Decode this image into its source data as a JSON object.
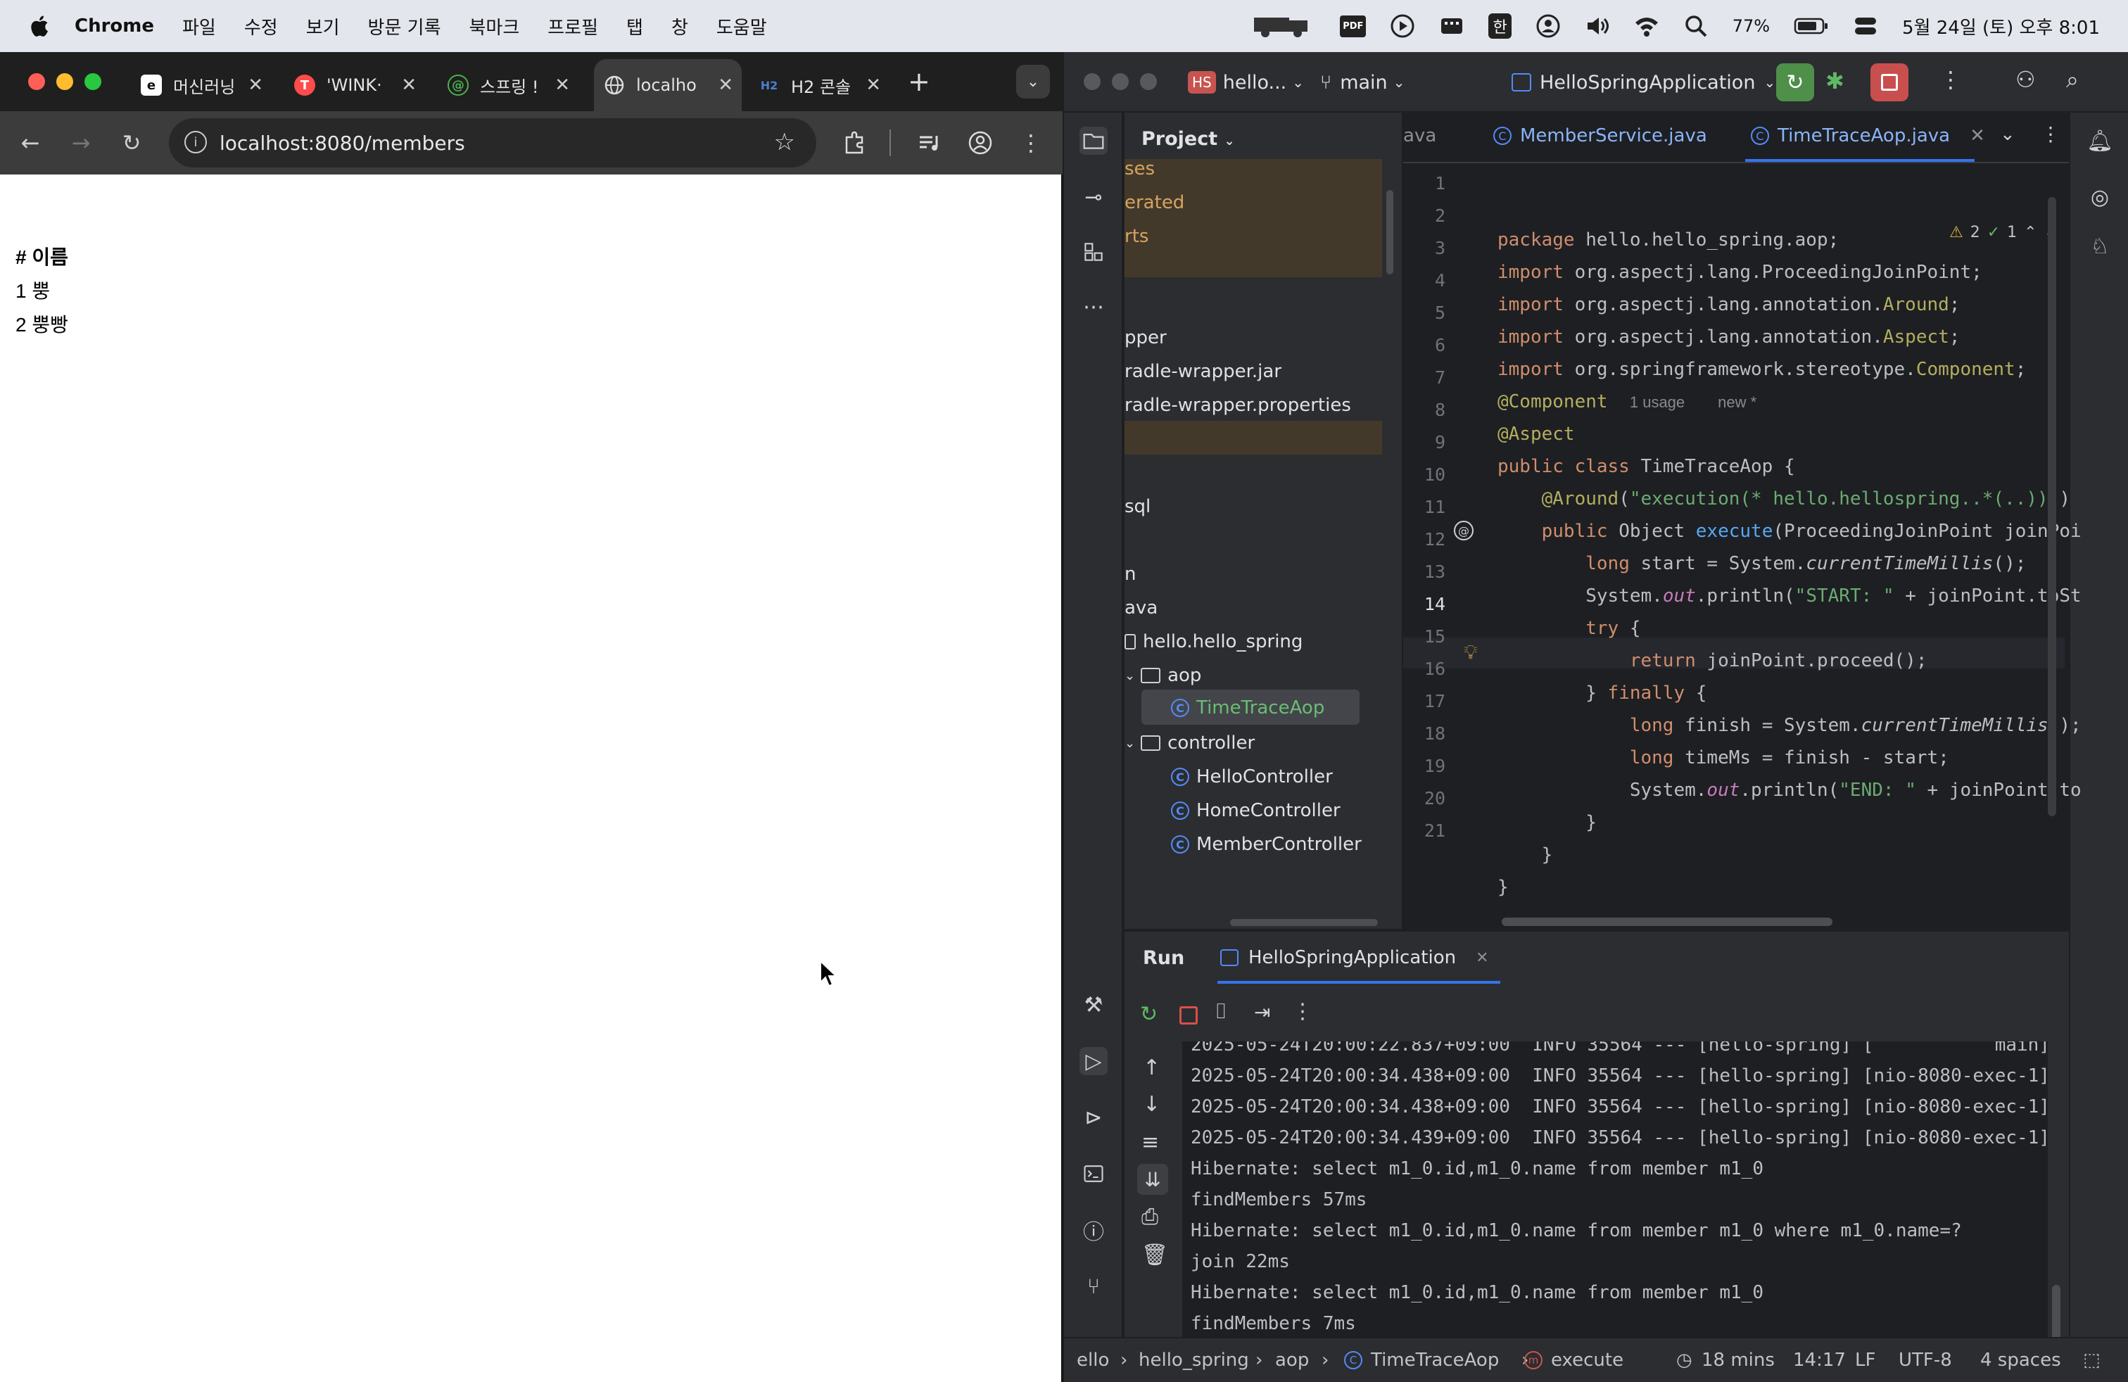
{
  "menubar": {
    "app": "Chrome",
    "items": [
      "파일",
      "수정",
      "보기",
      "방문 기록",
      "북마크",
      "프로필",
      "탭",
      "창",
      "도움말"
    ],
    "battery": "77%",
    "clock": "5월 24일 (토) 오후 8:01",
    "input_lang": "한",
    "pdf_label": "PDF"
  },
  "chrome": {
    "tabs": [
      {
        "title": "머신러닝",
        "favicon": "e"
      },
      {
        "title": "'WINK·",
        "favicon": "T"
      },
      {
        "title": "스프링 !",
        "favicon": "@"
      },
      {
        "title": "localho",
        "favicon": "globe"
      },
      {
        "title": "H2 콘솔",
        "favicon": "H2"
      }
    ],
    "url": "localhost:8080/members"
  },
  "page": {
    "header": "# 이름",
    "rows": [
      {
        "id": "1",
        "name": "뿡"
      },
      {
        "id": "2",
        "name": "뿡빵"
      }
    ]
  },
  "ide": {
    "project_badge": "HS",
    "project_name": "hello...",
    "branch": "main",
    "run_config": "HelloSpringApplication",
    "project_panel_title": "Project",
    "tree": [
      {
        "label": "ses"
      },
      {
        "label": "erated"
      },
      {
        "label": "rts"
      },
      {
        "label": "pper"
      },
      {
        "label": "radle-wrapper.jar"
      },
      {
        "label": "radle-wrapper.properties"
      },
      {
        "label": "sql"
      },
      {
        "label": "n"
      },
      {
        "label": "ava"
      },
      {
        "label": "hello.hello_spring"
      },
      {
        "label": "aop"
      },
      {
        "label": "TimeTraceAop"
      },
      {
        "label": "controller"
      },
      {
        "label": "HelloController"
      },
      {
        "label": "HomeController"
      },
      {
        "label": "MemberController"
      }
    ],
    "editor_tabs": [
      "ava",
      "MemberService.java",
      "TimeTraceAop.java"
    ],
    "inspections": {
      "warnings": "2",
      "ok": "1",
      "caret_line": "14"
    },
    "line_numbers": [
      "1",
      "2",
      "3",
      "4",
      "5",
      "6",
      "7",
      "8",
      "9",
      "10",
      "11",
      "12",
      "13",
      "14",
      "15",
      "16",
      "17",
      "18",
      "19",
      "20",
      "21"
    ],
    "code_hints": {
      "usage": "1 usage",
      "new": "new *"
    },
    "run_tab": "Run",
    "run_config_tab": "HelloSpringApplication",
    "console": [
      "2025-05-24T20:00:22.837+09:00  INFO 35564 --- [hello-spring] [           main]",
      "2025-05-24T20:00:34.438+09:00  INFO 35564 --- [hello-spring] [nio-8080-exec-1]",
      "2025-05-24T20:00:34.438+09:00  INFO 35564 --- [hello-spring] [nio-8080-exec-1]",
      "2025-05-24T20:00:34.439+09:00  INFO 35564 --- [hello-spring] [nio-8080-exec-1]",
      "Hibernate: select m1_0.id,m1_0.name from member m1_0",
      "findMembers 57ms",
      "Hibernate: select m1_0.id,m1_0.name from member m1_0 where m1_0.name=?",
      "join 22ms",
      "Hibernate: select m1_0.id,m1_0.name from member m1_0",
      "findMembers 7ms"
    ],
    "status": {
      "crumb1": "ello",
      "crumb2": "hello_spring",
      "crumb3": "aop",
      "crumb4": "TimeTraceAop",
      "crumb5": "execute",
      "elapsed": "18 mins",
      "position": "14:17",
      "line_sep": "LF",
      "encoding": "UTF-8",
      "indent": "4 spaces"
    }
  }
}
